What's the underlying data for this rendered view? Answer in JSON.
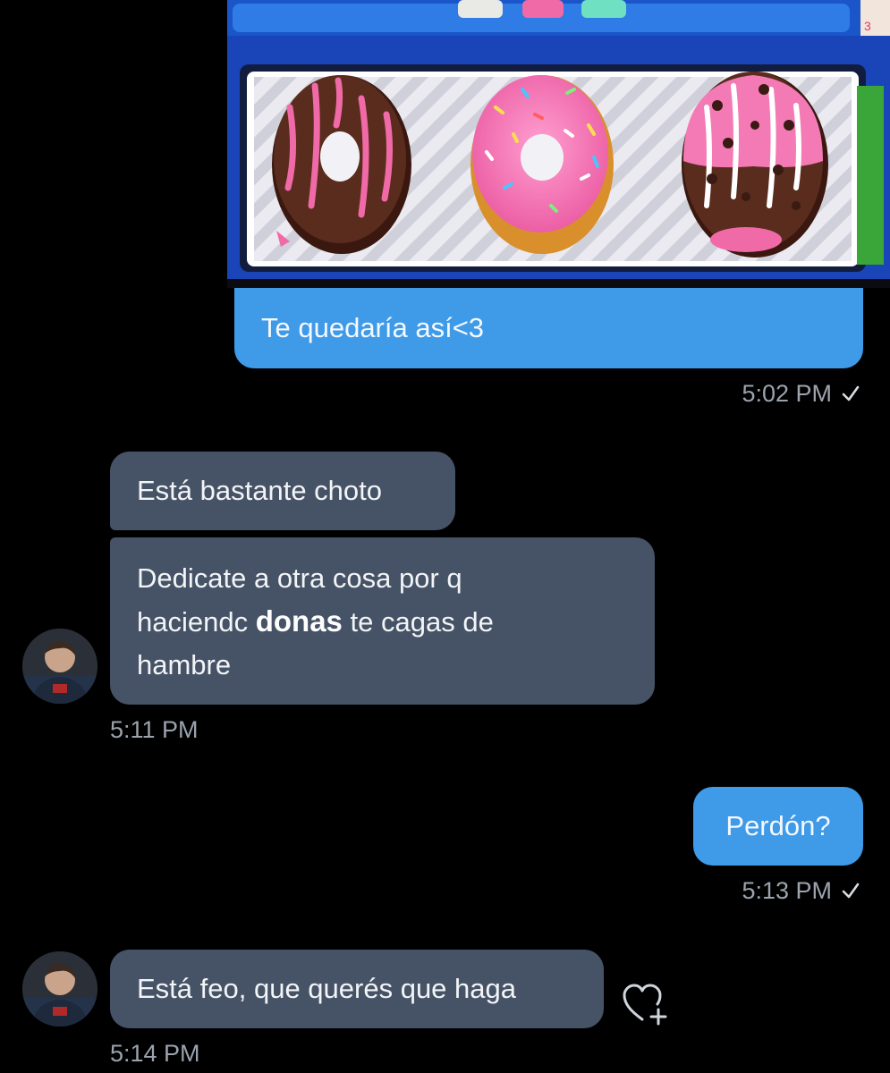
{
  "conversation": {
    "messages": [
      {
        "direction": "outgoing",
        "type": "image_with_caption",
        "image": {
          "alt": "three decorated donuts on a tray",
          "icon": "donut-tray-image",
          "colors": {
            "frame": "#1a55c9",
            "tray": "#e9e9ee",
            "chocolate": "#5a2c1e",
            "pink_icing": "#f47ab6",
            "dough": "#e8a94a"
          }
        },
        "text": "Te quedaría así<3",
        "time": "5:02 PM",
        "status_icon": "check-icon"
      },
      {
        "direction": "incoming",
        "text": "Está bastante choto",
        "time": null
      },
      {
        "direction": "incoming",
        "text_parts": {
          "line1": "Dedicate a otra cosa por q",
          "line2_pre": "haciendc",
          "line2_bold": "donas",
          "line2_post": "te cagas de",
          "line3": "hambre"
        },
        "time": "5:11 PM",
        "avatar_icon": "user-avatar"
      },
      {
        "direction": "outgoing",
        "text": "Perdón?",
        "time": "5:13 PM",
        "status_icon": "check-icon"
      },
      {
        "direction": "incoming",
        "text": "Está feo, que querés que haga",
        "time": "5:14 PM",
        "avatar_icon": "user-avatar",
        "reaction_icon": "heart-add-icon"
      }
    ],
    "colors": {
      "background": "#000000",
      "outgoing_bubble": "#3f9ae8",
      "incoming_bubble": "#465366",
      "timestamp": "#9aa3ae"
    }
  }
}
